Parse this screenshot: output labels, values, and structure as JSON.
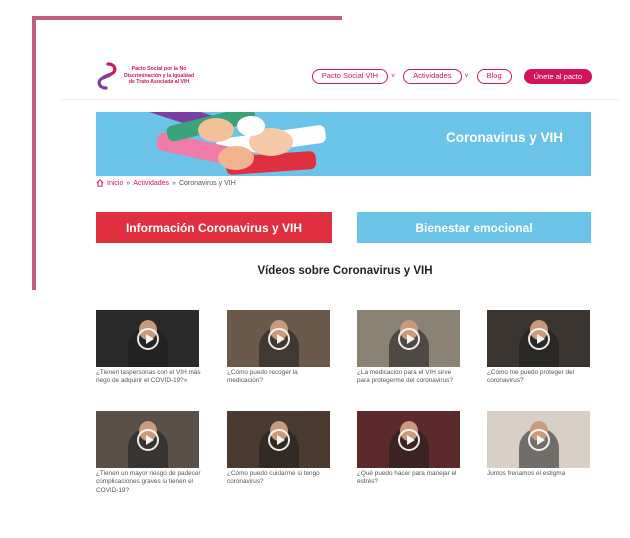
{
  "header": {
    "logo_text": "Pacto Social por la No Discriminación y la Igualdad de Trato Asociada al VIH",
    "nav": [
      {
        "label": "Pacto Social VIH",
        "has_dropdown": true
      },
      {
        "label": "Actividades",
        "has_dropdown": true
      },
      {
        "label": "Blog",
        "has_dropdown": false
      }
    ],
    "cta_label": "Únete al pacto"
  },
  "banner": {
    "title": "Coronavirus y VIH"
  },
  "breadcrumb": {
    "home": "Inicio",
    "sep": "»",
    "parent": "Actividades",
    "current": "Coronavirus y VIH"
  },
  "actions": {
    "info_label": "Información Coronavirus y VIH",
    "wellbeing_label": "Bienestar emocional"
  },
  "videos_section": {
    "title": "Vídeos sobre Coronavirus y VIH",
    "videos": [
      {
        "caption": "¿Tienen laspersonas con el VIH más riego de adquirir el COVID-19?»",
        "bg": "#2a2a2a"
      },
      {
        "caption": "¿Cómo puedo recoger la medicación?",
        "bg": "#6b5a4a"
      },
      {
        "caption": "¿La medicación para el VIH sirve para protegerme del coronavirus?",
        "bg": "#8a8272"
      },
      {
        "caption": "¿Cómo me puedo proteger del coronavirus?",
        "bg": "#3a3530"
      },
      {
        "caption": "¿Tienen un mayor riesgo de padecer complicaciones graves si tienen el COVID-19?",
        "bg": "#5a5048"
      },
      {
        "caption": "¿Cómo puedo cuidarme si tengo coronavirus?",
        "bg": "#4a3a30"
      },
      {
        "caption": "¿Qué puedo hacer para manejar el estrés?",
        "bg": "#5c2a2a"
      },
      {
        "caption": "Juntos frenamos el estigma",
        "bg": "#d8d0c6"
      }
    ]
  },
  "colors": {
    "brand": "#d4145a",
    "sky": "#6cc3e8",
    "red": "#e0303f",
    "frame": "#c0607a"
  }
}
